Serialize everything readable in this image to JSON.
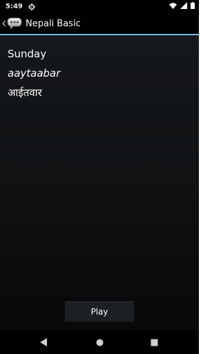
{
  "status_bar": {
    "time": "5:49"
  },
  "action_bar": {
    "title": "Nepali Basic"
  },
  "entry": {
    "english": "Sunday",
    "transliteration": "aaytaabar",
    "nepali": "आईतवार"
  },
  "controls": {
    "play_label": "Play"
  },
  "icons": {
    "gear": "gear-icon",
    "wifi": "wifi-icon",
    "signal": "signal-icon",
    "battery": "battery-icon",
    "back": "back-icon",
    "home": "home-icon",
    "recents": "recents-icon",
    "app": "speech-bubble-icon",
    "up": "chevron-left-icon"
  },
  "colors": {
    "accent_divider": "#7fb9d6",
    "background_top": "#171a1d",
    "background_bottom": "#060708"
  }
}
